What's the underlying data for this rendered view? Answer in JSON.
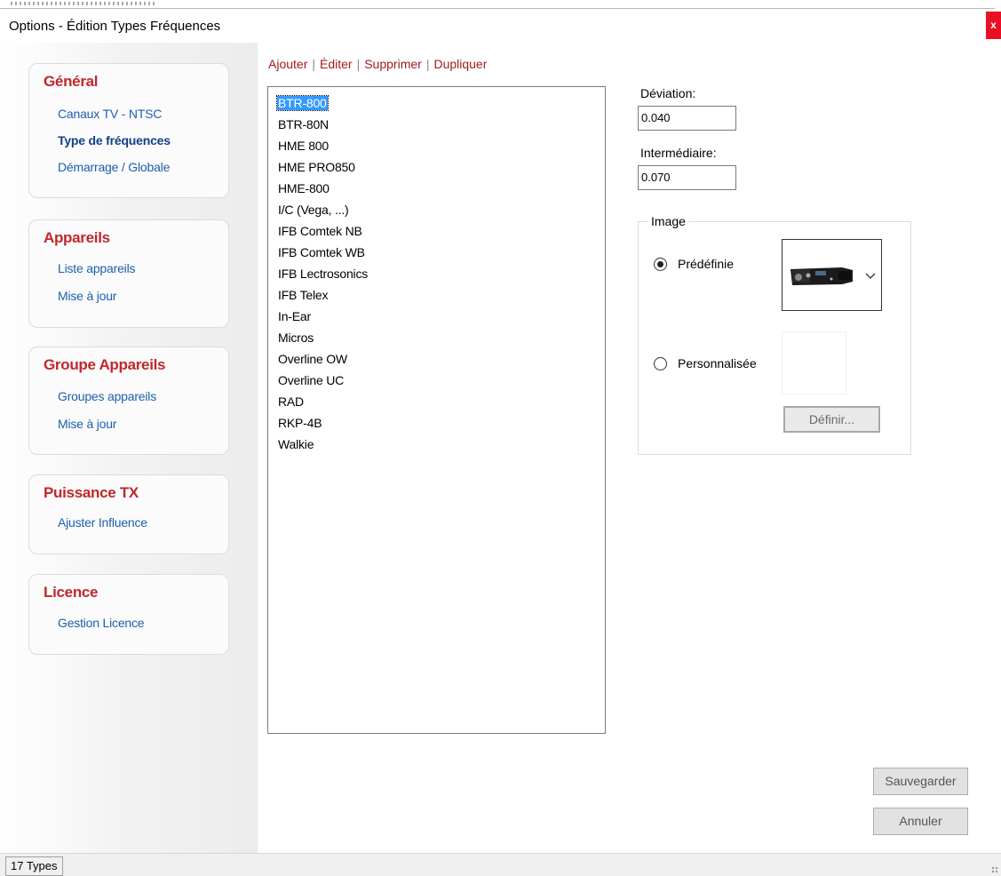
{
  "window": {
    "title": "Options - Édition Types Fréquences",
    "close_label": "x"
  },
  "sidebar": {
    "sections": [
      {
        "title": "Général",
        "items": [
          {
            "label": "Canaux TV - NTSC",
            "active": false
          },
          {
            "label": "Type de fréquences",
            "active": true
          },
          {
            "label": "Démarrage / Globale",
            "active": false
          }
        ]
      },
      {
        "title": "Appareils",
        "items": [
          {
            "label": "Liste appareils",
            "active": false
          },
          {
            "label": "Mise à jour",
            "active": false
          }
        ]
      },
      {
        "title": "Groupe Appareils",
        "items": [
          {
            "label": "Groupes appareils",
            "active": false
          },
          {
            "label": "Mise à jour",
            "active": false
          }
        ]
      },
      {
        "title": "Puissance TX",
        "items": [
          {
            "label": "Ajuster Influence",
            "active": false
          }
        ]
      },
      {
        "title": "Licence",
        "items": [
          {
            "label": "Gestion Licence",
            "active": false
          }
        ]
      }
    ]
  },
  "toolbar": {
    "add": "Ajouter",
    "edit": "Éditer",
    "delete": "Supprimer",
    "duplicate": "Dupliquer",
    "separator": "|"
  },
  "types_list": {
    "selected_index": 0,
    "items": [
      "BTR-800",
      "BTR-80N",
      "HME 800",
      "HME PRO850",
      "HME-800",
      "I/C (Vega, ...)",
      "IFB Comtek NB",
      "IFB Comtek WB",
      "IFB Lectrosonics",
      "IFB Telex",
      "In-Ear",
      "Micros",
      "Overline OW",
      "Overline UC",
      "RAD",
      "RKP-4B",
      "Walkie"
    ]
  },
  "form": {
    "deviation": {
      "label": "Déviation:",
      "value": "0.040"
    },
    "intermediate": {
      "label": "Intermédiaire:",
      "value": "0.070"
    },
    "image_group": {
      "title": "Image",
      "predefined_label": "Prédéfinie",
      "custom_label": "Personnalisée",
      "selected": "predefined",
      "define_button": "Définir..."
    }
  },
  "buttons": {
    "save": "Sauvegarder",
    "cancel": "Annuler"
  },
  "status": {
    "count": "17 Types"
  },
  "icons": {
    "close": "close-icon",
    "dropdown": "chevron-down-icon",
    "device": "radio-receiver-icon",
    "grip": "resize-grip-icon"
  }
}
